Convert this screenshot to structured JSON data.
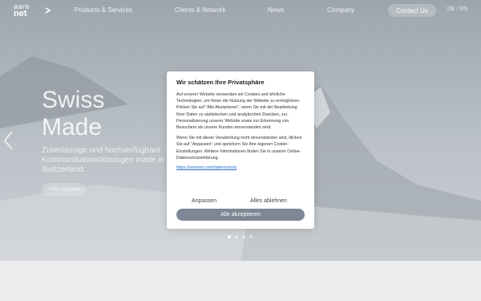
{
  "nav": {
    "logo_line1": "aare",
    "logo_line2": "net",
    "links": [
      "Products & Services",
      "Clients & Network",
      "News",
      "Company"
    ],
    "contact_label": "Contact Us",
    "lang_de": "DE",
    "lang_sep": "/",
    "lang_en": "EN"
  },
  "hero": {
    "title_line1": "Swiss",
    "title_line2": "Made",
    "text": "Zuverlässige und hochverfügbare Kommunikationslösungen made in Switzerland.",
    "button_label": "Mehr erfahren",
    "slides_total": 4,
    "slide_active": 1
  },
  "modal": {
    "title": "Wir schätzen Ihre Privatsphäre",
    "paragraph1": "Auf unserer Website verwenden wir Cookies und ähnliche Technologien, um Ihnen die Nutzung der Website zu ermöglichen. Klicken Sie auf \"Alle Akzeptieren\", wenn Sie mit der Bearbeitung Ihrer Daten zu statistischen und analytischen Zwecken, zur Personalisierung unserer Website sowie zur Erkennung von Besuchern als unsere Kunden einverstanden sind.",
    "paragraph2": "Wenn Sie mit dieser Verarbeitung nicht einverstanden sind, klicken Sie auf \"Anpassen\" und speichern Sie Ihre eigenen Cookie-Einstellungen. Weitere Informationen finden Sie in unserer Online-Datenschutzerklärung.",
    "link": "https://aarenet.com/datenschutz",
    "customize_label": "Anpassen",
    "reject_label": "Alles ablehnen",
    "accept_label": "Alle akzeptieren"
  },
  "colors": {
    "accept_button": "#7d8795",
    "link": "#2a6fd0"
  }
}
